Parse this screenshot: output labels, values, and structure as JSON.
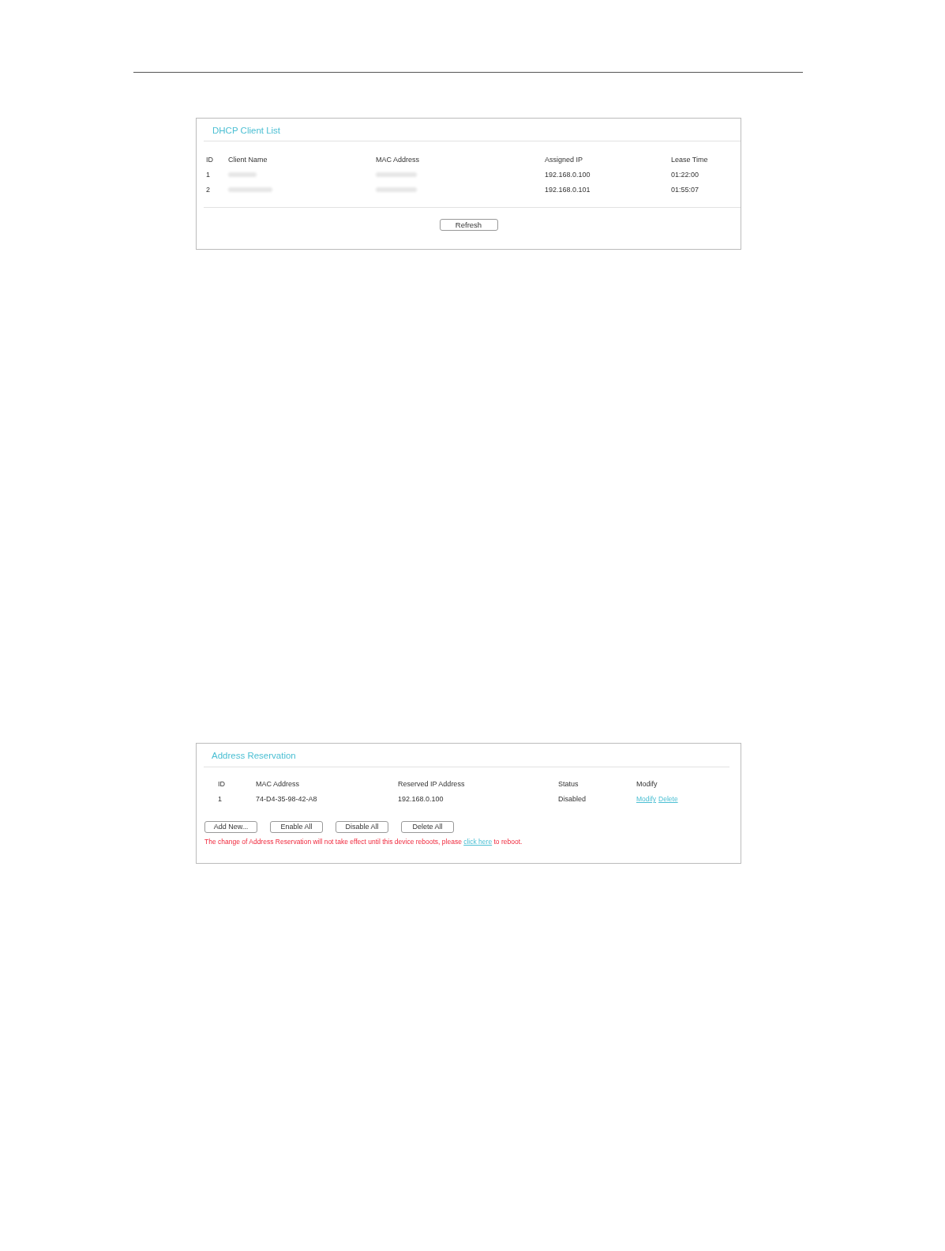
{
  "dhcp_client_list": {
    "title": "DHCP Client List",
    "columns": [
      "ID",
      "Client Name",
      "MAC Address",
      "Assigned IP",
      "Lease Time"
    ],
    "rows": [
      {
        "id": "1",
        "redacted": true,
        "assigned_ip": "192.168.0.100",
        "lease_time": "01:22:00"
      },
      {
        "id": "2",
        "redacted": true,
        "assigned_ip": "192.168.0.101",
        "lease_time": "01:55:07"
      }
    ],
    "buttons": [
      "Refresh"
    ]
  },
  "address_reservation": {
    "title": "Address Reservation",
    "columns": [
      "ID",
      "MAC Address",
      "Reserved IP Address",
      "Status",
      "Modify"
    ],
    "rows": [
      {
        "id": "1",
        "mac_address": "74-D4-35-98-42-A8",
        "reserved_ip": "192.168.0.100",
        "status": "Disabled",
        "links": [
          "Modify",
          "Delete"
        ]
      }
    ],
    "buttons": [
      "Add New...",
      "Enable All",
      "Disable All",
      "Delete All"
    ],
    "notice": {
      "before": "The change of Address Reservation will not take effect until this device reboots, please",
      "link": "click here",
      "after": "to reboot."
    }
  }
}
